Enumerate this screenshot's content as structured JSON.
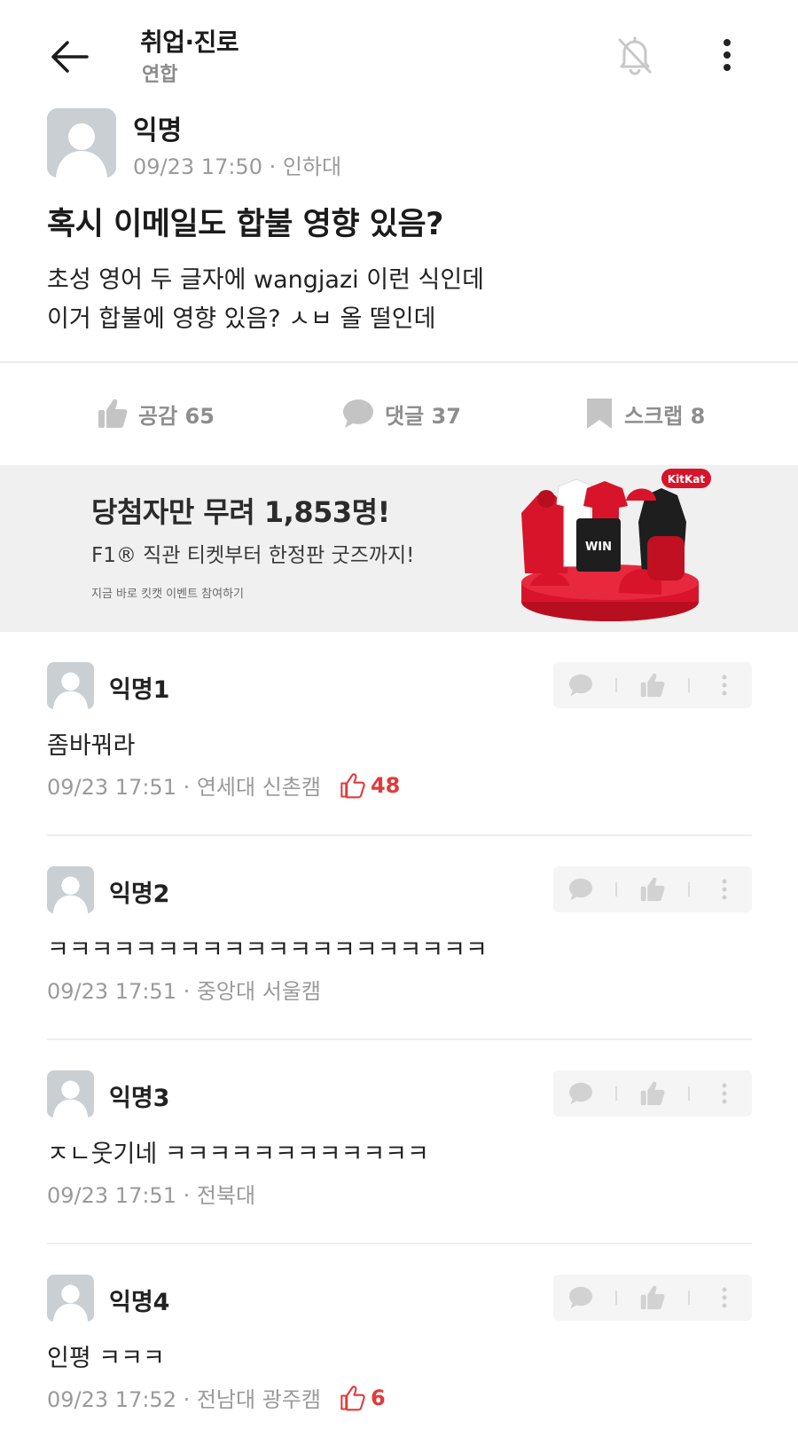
{
  "header": {
    "board_title": "취업·진로",
    "board_subtitle": "연합",
    "icons": {
      "back": "arrow-left-icon",
      "notify": "bell-off-icon",
      "more": "more-vertical-icon"
    }
  },
  "post": {
    "author": "익명",
    "meta": "09/23 17:50 · 인하대",
    "title": "혹시 이메일도 합불 영향 있음?",
    "body": "초성 영어 두 글자에 wangjazi 이런 식인데\n이거 합불에 영향 있음? ㅅㅂ 올 떨인데"
  },
  "actions": {
    "like": "공감 65",
    "comment": "댓글 37",
    "scrap": "스크랩 8",
    "color": "#8e8e8e"
  },
  "ad": {
    "headline": "당첨자만 무려 1,853명!",
    "subline": "F1® 직관 티켓부터 한정판 굿즈까지!",
    "small": "지금 바로 킷캣 이벤트 참여하기",
    "brand_badge": "KitKat",
    "win_label": "WIN",
    "brand_color": "#d8142a"
  },
  "comments": [
    {
      "author": "익명1",
      "body": "좀바꿔라",
      "meta": "09/23 17:51 · 연세대 신촌캠",
      "likes": "48"
    },
    {
      "author": "익명2",
      "body": "ㅋㅋㅋㅋㅋㅋㅋㅋㅋㅋㅋㅋㅋㅋㅋㅋㅋㅋㅋㅋ",
      "meta": "09/23 17:51 · 중앙대 서울캠",
      "likes": ""
    },
    {
      "author": "익명3",
      "body": "ㅈㄴ웃기네 ㅋㅋㅋㅋㅋㅋㅋㅋㅋㅋㅋㅋ",
      "meta": "09/23 17:51 · 전북대",
      "likes": ""
    },
    {
      "author": "익명4",
      "body": "인평 ㅋㅋㅋ",
      "meta": "09/23 17:52 · 전남대 광주캠",
      "likes": "6"
    }
  ],
  "colors": {
    "like_red": "#e03a3a",
    "meta_gray": "#9a9a9a",
    "avatar_gray": "#c9cfd3"
  }
}
